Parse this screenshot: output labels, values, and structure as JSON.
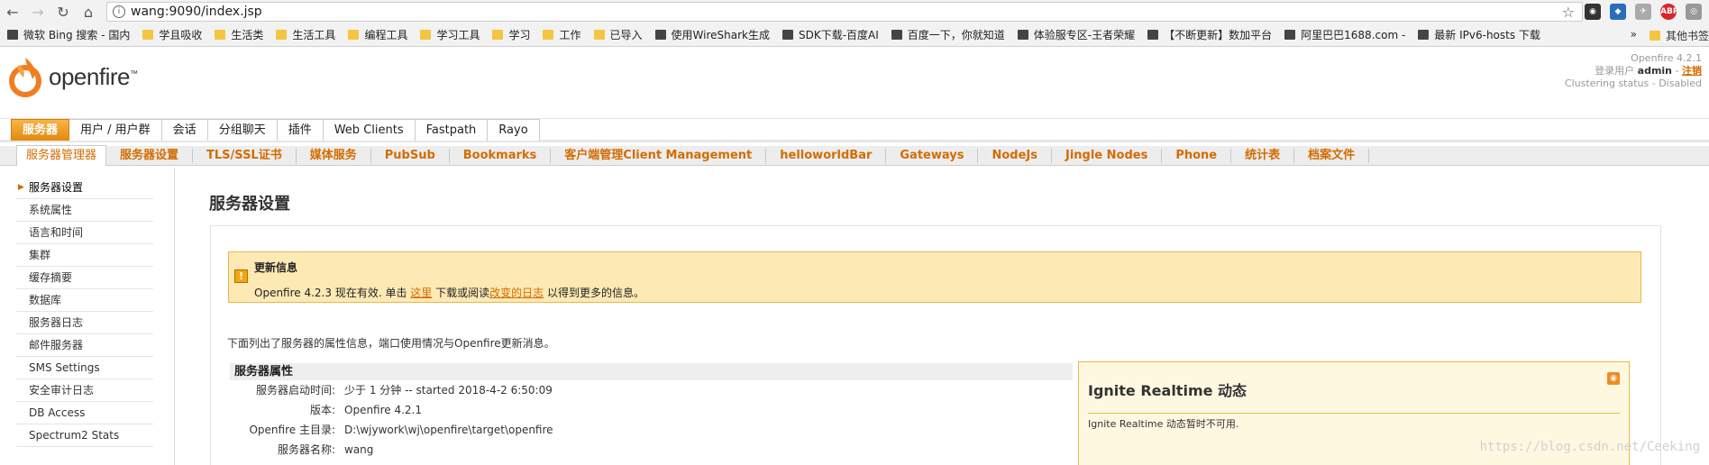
{
  "browser": {
    "url": "wang:9090/index.jsp",
    "bookmarks": [
      {
        "label": "微软 Bing 搜索 - 国内",
        "icon": "bing-icon"
      },
      {
        "label": "学且吸收",
        "icon": "folder-icon"
      },
      {
        "label": "生活类",
        "icon": "folder-icon"
      },
      {
        "label": "生活工具",
        "icon": "folder-icon"
      },
      {
        "label": "编程工具",
        "icon": "folder-icon"
      },
      {
        "label": "学习工具",
        "icon": "folder-icon"
      },
      {
        "label": "学习",
        "icon": "folder-icon"
      },
      {
        "label": "工作",
        "icon": "folder-icon"
      },
      {
        "label": "已导入",
        "icon": "folder-icon"
      },
      {
        "label": "使用WireShark生成",
        "icon": "wireshark-icon"
      },
      {
        "label": "SDK下载-百度AI",
        "icon": "ai-icon"
      },
      {
        "label": "百度一下，你就知道",
        "icon": "baidu-icon"
      },
      {
        "label": "体验服专区-王者荣耀",
        "icon": "game-icon"
      },
      {
        "label": "【不断更新】数加平台",
        "icon": "link-icon"
      },
      {
        "label": "阿里巴巴1688.com -",
        "icon": "alibaba-icon"
      },
      {
        "label": "最新 IPv6-hosts 下载",
        "icon": "doc-icon"
      }
    ],
    "more_label": "»",
    "other_bookmarks": "其他书签"
  },
  "header": {
    "logo_text": "openfire",
    "logo_tm": "™",
    "version": "Openfire 4.2.1",
    "login_prefix": "登录用户",
    "login_user": "admin",
    "login_sep": " - ",
    "logout": "注销",
    "clustering": "Clustering status - Disabled"
  },
  "main_tabs": [
    {
      "label": "服务器",
      "active": true
    },
    {
      "label": "用户 / 用户群",
      "active": false
    },
    {
      "label": "会话",
      "active": false
    },
    {
      "label": "分组聊天",
      "active": false
    },
    {
      "label": "插件",
      "active": false
    },
    {
      "label": "Web Clients",
      "active": false
    },
    {
      "label": "Fastpath",
      "active": false
    },
    {
      "label": "Rayo",
      "active": false
    }
  ],
  "sub_tabs": [
    "服务器管理器",
    "服务器设置",
    "TLS/SSL证书",
    "媒体服务",
    "PubSub",
    "Bookmarks",
    "客户端管理Client Management",
    "helloworldBar",
    "Gateways",
    "NodeJs",
    "Jingle Nodes",
    "Phone",
    "统计表",
    "档案文件"
  ],
  "sidebar": {
    "items": [
      "服务器设置",
      "系统属性",
      "语言和时间",
      "集群",
      "缓存摘要",
      "数据库",
      "服务器日志",
      "邮件服务器",
      "SMS Settings",
      "安全审计日志",
      "DB Access",
      "Spectrum2 Stats"
    ]
  },
  "main": {
    "title": "服务器设置",
    "update": {
      "title": "更新信息",
      "msg_prefix": "Openfire 4.2.3 现在有效. 单击 ",
      "link_here": "这里",
      "msg_mid": " 下载或阅读",
      "link_log": "改变的日志",
      "msg_suffix": " 以得到更多的信息。"
    },
    "intro": "下面列出了服务器的属性信息，端口使用情况与Openfire更新消息。",
    "props_title": "服务器属性",
    "props": [
      {
        "key": "服务器启动时间:",
        "value": "少于 1 分钟 -- started 2018-4-2 6:50:09"
      },
      {
        "key": "版本:",
        "value": "Openfire 4.2.1"
      },
      {
        "key": "Openfire 主目录:",
        "value": "D:\\wjywork\\wj\\openfire\\target\\openfire"
      },
      {
        "key": "服务器名称:",
        "value": "wang"
      }
    ],
    "ignite": {
      "title": "Ignite Realtime 动态",
      "msg": "Ignite Realtime 动态暂时不可用."
    }
  },
  "watermark": "https://blog.csdn.net/Ceeking",
  "colors": {
    "accent": "#d46c00",
    "tab_active": "#f19b1c",
    "warn_bg": "#fde9b4"
  }
}
